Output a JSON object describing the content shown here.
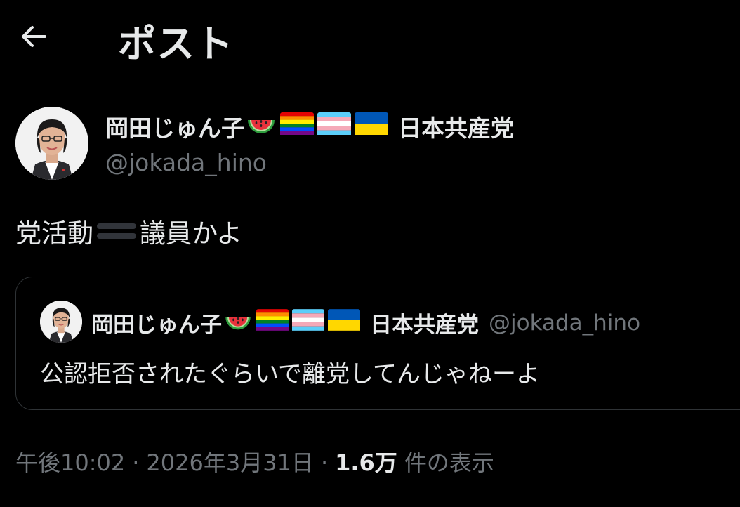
{
  "header": {
    "title": "ポスト",
    "back_icon": "arrow-left-icon"
  },
  "tweet": {
    "author": {
      "name": "岡田じゅん子",
      "party": "日本共産党",
      "handle": "@jokada_hino",
      "emojis": [
        "watermelon-icon",
        "rainbow-flag-icon",
        "transgender-flag-icon",
        "ukraine-flag-icon"
      ]
    },
    "text_before": "党活動",
    "text_after": "議員かよ",
    "quote": {
      "name": "岡田じゅん子",
      "party": "日本共産党",
      "handle": "@jokada_hino",
      "text": "公認拒否されたぐらいで離党してんじゃねーよ"
    },
    "time": "午後10:02",
    "separator": "·",
    "date": "2026年3月31日",
    "views_count": "1.6万",
    "views_label": "件の表示"
  },
  "colors": {
    "background": "#000000",
    "text_primary": "#e7e9ea",
    "text_secondary": "#71767b",
    "border": "#2f3336"
  }
}
